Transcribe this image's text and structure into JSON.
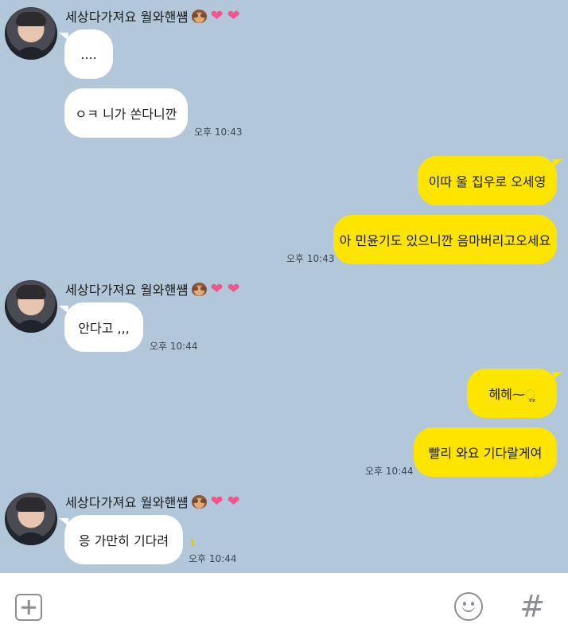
{
  "chat": {
    "sender_name": "세상다가져요 월와핸썜",
    "sender_emoji_icons": [
      "see-no-evil-monkey-icon",
      "heart-icon",
      "heart-icon"
    ],
    "accent_in": "#ffffff",
    "accent_out": "#fee500",
    "background": "#b2c7da",
    "messages": [
      {
        "dir": "in",
        "text": "....",
        "time": ""
      },
      {
        "dir": "in",
        "text": "ㅇㅋ 니가 쏜다니깐",
        "time": "오후 10:43"
      },
      {
        "dir": "out",
        "text": "이따 울 집우로 오세영",
        "time": ""
      },
      {
        "dir": "out",
        "text": "아 민윤기도 있으니깐 음마버리고오세요",
        "time": "오후 10:43"
      },
      {
        "dir": "in",
        "text": "안다고 ,,,",
        "time": "오후 10:44"
      },
      {
        "dir": "out",
        "text": "헤헤⁓ૢ",
        "time": ""
      },
      {
        "dir": "out",
        "text": "빨리 와요 기다랄게여",
        "time": "오후 10:44"
      },
      {
        "dir": "in",
        "text": "응 가만히 기다려",
        "time": "오후 10:44",
        "unread": "1"
      }
    ]
  },
  "input_bar": {
    "plus_icon": "plus-square-icon",
    "emoji_icon": "smiley-icon",
    "hash_label": "#"
  }
}
